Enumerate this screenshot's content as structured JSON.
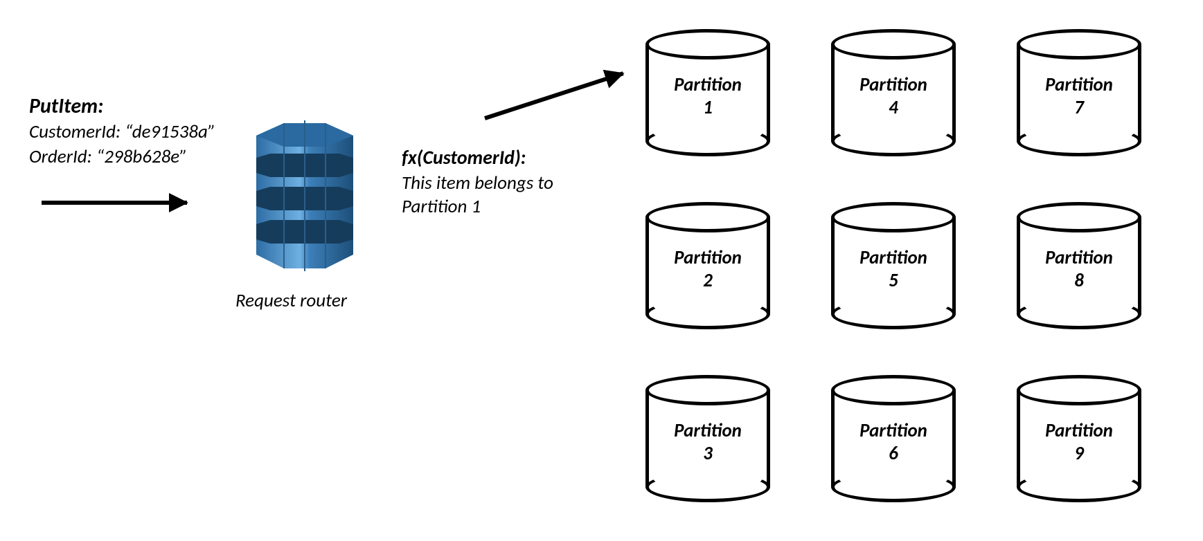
{
  "request": {
    "operation": "PutItem:",
    "customer": "CustomerId: “de91538a”",
    "order": "OrderId: “298b628e”"
  },
  "fx": {
    "title": "fx(CustomerId):",
    "line1": "This item belongs to",
    "line2": "Partition 1"
  },
  "router_caption": "Request router",
  "partitions": [
    {
      "label_word": "Partition",
      "num": "1"
    },
    {
      "label_word": "Partition",
      "num": "2"
    },
    {
      "label_word": "Partition",
      "num": "3"
    },
    {
      "label_word": "Partition",
      "num": "4"
    },
    {
      "label_word": "Partition",
      "num": "5"
    },
    {
      "label_word": "Partition",
      "num": "6"
    },
    {
      "label_word": "Partition",
      "num": "7"
    },
    {
      "label_word": "Partition",
      "num": "8"
    },
    {
      "label_word": "Partition",
      "num": "9"
    }
  ]
}
